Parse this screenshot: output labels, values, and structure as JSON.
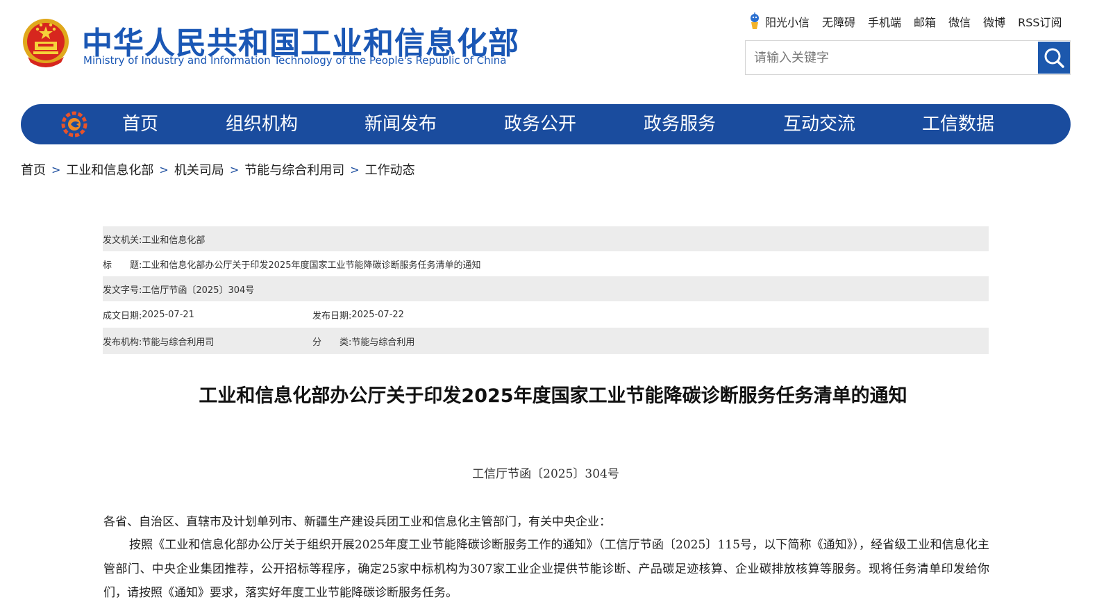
{
  "header": {
    "site_title": "中华人民共和国工业和信息化部",
    "site_subtitle": "Ministry of Industry and Information Technology of the People's Republic of China",
    "toplinks": [
      "阳光小信",
      "无障碍",
      "手机端",
      "邮箱",
      "微信",
      "微博",
      "RSS订阅"
    ],
    "search_placeholder": "请输入关键字"
  },
  "nav": {
    "items": [
      "首页",
      "组织机构",
      "新闻发布",
      "政务公开",
      "政务服务",
      "互动交流",
      "工信数据"
    ]
  },
  "breadcrumb": [
    "首页",
    "工业和信息化部",
    "机关司局",
    "节能与综合利用司",
    "工作动态"
  ],
  "breadcrumb_sep": ">",
  "meta": {
    "issuer_label": "发文机关:",
    "issuer": "工业和信息化部",
    "title_label": "标　　题:",
    "title": "工业和信息化部办公厅关于印发2025年度国家工业节能降碳诊断服务任务清单的通知",
    "doc_no_label": "发文字号:",
    "doc_no": "工信厅节函〔2025〕304号",
    "written_date_label": "成文日期:",
    "written_date": "2025-07-21",
    "publish_date_label": "发布日期:",
    "publish_date": "2025-07-22",
    "publisher_label": "发布机构:",
    "publisher": "节能与综合利用司",
    "category_label": "分　　类:",
    "category": "节能与综合利用"
  },
  "article": {
    "title": "工业和信息化部办公厅关于印发2025年度国家工业节能降碳诊断服务任务清单的通知",
    "doc_number": "工信厅节函〔2025〕304号",
    "salutation": "各省、自治区、直辖市及计划单列市、新疆生产建设兵团工业和信息化主管部门，有关中央企业：",
    "paragraph": "按照《工业和信息化部办公厅关于组织开展2025年度工业节能降碳诊断服务工作的通知》（工信厅节函〔2025〕115号，以下简称《通知》），经省级工业和信息化主管部门、中央企业集团推荐，公开招标等程序，确定25家中标机构为307家工业企业提供节能诊断、产品碳足迹核算、企业碳排放核算等服务。现将任务清单印发给你们，请按照《通知》要求，落实好年度工业节能降碳诊断服务任务。"
  },
  "colors": {
    "brand_blue": "#1a4c9e",
    "title_blue": "#1a57b5",
    "meta_shade": "#ececec"
  }
}
